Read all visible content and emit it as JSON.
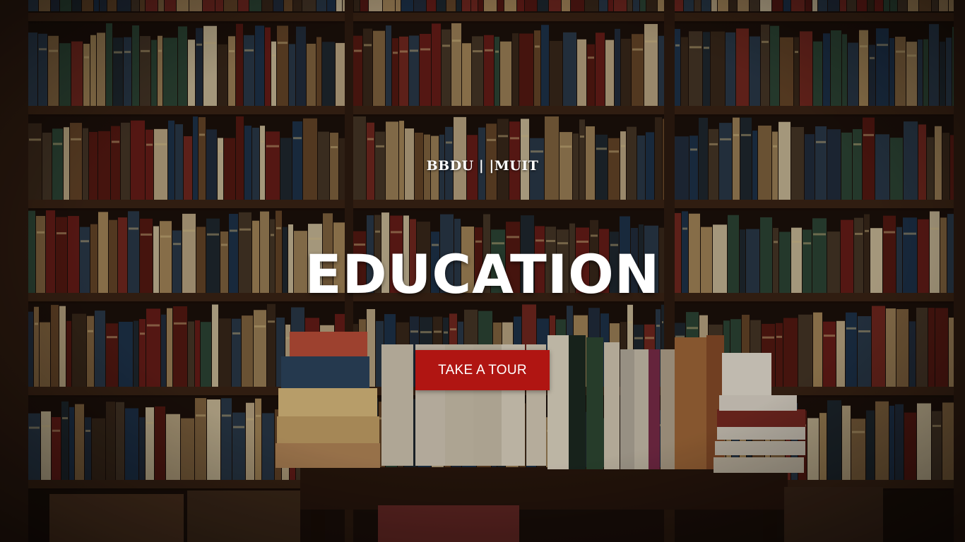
{
  "hero": {
    "brand": "BBDU | |MUIT",
    "title": "EDUCATION",
    "cta_label": "TAKE A TOUR",
    "background_icon": "bookshelf-background-image"
  },
  "colors": {
    "cta_background": "#b01512",
    "text": "#ffffff",
    "wood": "#3b2415"
  }
}
